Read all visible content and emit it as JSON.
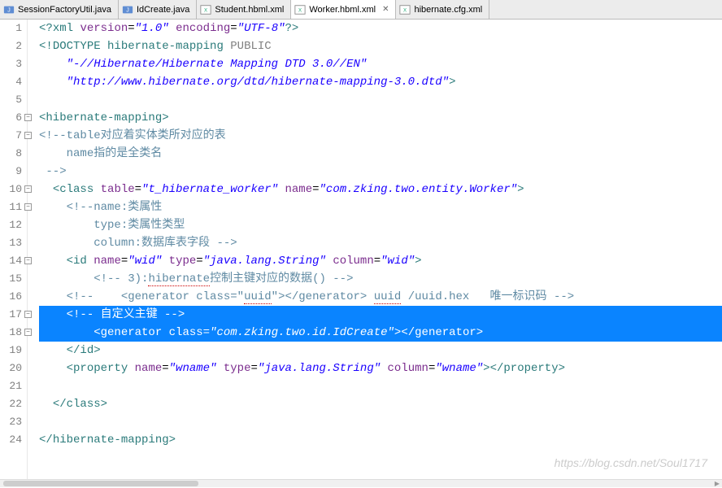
{
  "tabs": [
    {
      "label": "SessionFactoryUtil.java",
      "type": "java"
    },
    {
      "label": "IdCreate.java",
      "type": "java"
    },
    {
      "label": "Student.hbml.xml",
      "type": "xml"
    },
    {
      "label": "Worker.hbml.xml",
      "type": "xml",
      "active": true
    },
    {
      "label": "hibernate.cfg.xml",
      "type": "xml"
    }
  ],
  "gutter": [
    "1",
    "2",
    "3",
    "4",
    "5",
    "6",
    "7",
    "8",
    "9",
    "10",
    "11",
    "12",
    "13",
    "14",
    "15",
    "16",
    "17",
    "18",
    "19",
    "20",
    "21",
    "22",
    "23",
    "24"
  ],
  "code": {
    "l1": {
      "pi1": "<?",
      "tag": "xml",
      "sp": " ",
      "a1": "version",
      "eq": "=",
      "v1": "\"1.0\"",
      "sp2": " ",
      "a2": "encoding",
      "v2": "\"UTF-8\"",
      "pi2": "?>"
    },
    "l2": {
      "d1": "<!",
      "d2": "DOCTYPE",
      "sp": " ",
      "name": "hibernate-mapping",
      "sp2": " ",
      "pub": "PUBLIC"
    },
    "l3": {
      "pad": "    ",
      "v": "\"-//Hibernate/Hibernate Mapping DTD 3.0//EN\""
    },
    "l4": {
      "pad": "    ",
      "v": "\"http://www.hibernate.org/dtd/hibernate-mapping-3.0.dtd\"",
      "close": ">"
    },
    "l5": "",
    "l6": {
      "open": "<",
      "tag": "hibernate-mapping",
      "close": ">"
    },
    "l7": {
      "open": "<!--",
      "t1": "table",
      "cjk": "对应着实体类所对应的表"
    },
    "l8": {
      "pad": "    ",
      "t": "name",
      "cjk": "指的是全类名"
    },
    "l9": {
      "pad": " ",
      "close": "-->"
    },
    "l10": {
      "pad": "  ",
      "open": "<",
      "tag": "class",
      "sp": " ",
      "a1": "table",
      "eq": "=",
      "v1": "\"t_hibernate_worker\"",
      "sp2": " ",
      "a2": "name",
      "v2": "\"com.zking.two.entity.Worker\"",
      "close": ">"
    },
    "l11": {
      "pad": "    ",
      "open": "<!--",
      "t1": "name:",
      "cjk": "类属性"
    },
    "l12": {
      "pad": "        ",
      "t1": "type:",
      "cjk": "类属性类型"
    },
    "l13": {
      "pad": "        ",
      "t1": "column:",
      "cjk": "数据库表字段",
      "sp": " ",
      "close": "-->"
    },
    "l14": {
      "pad": "    ",
      "open": "<",
      "tag": "id",
      "sp": " ",
      "a1": "name",
      "eq": "=",
      "v1": "\"wid\"",
      "sp2": " ",
      "a2": "type",
      "v2": "\"java.lang.String\"",
      "sp3": " ",
      "a3": "column",
      "v3": "\"wid\"",
      "close": ">"
    },
    "l15": {
      "pad": "        ",
      "open": "<!--",
      "t1": " 3):",
      "sq": "hibernate",
      "cjk": "控制主键对应的数据",
      "paren": "()",
      "sp": " ",
      "close": "-->"
    },
    "l16": {
      "pad": "    ",
      "open": "<!--",
      "sp": "    ",
      "t1": "<generator class=\"",
      "uuid": "uuid",
      "t2": "\"></generator> ",
      "sq": "uuid",
      "t3": " /uuid.hex   ",
      "cjk": "唯一标识码",
      "sp2": " ",
      "close": "-->"
    },
    "l17": {
      "pad": "    ",
      "open": "<!--",
      "sp": " ",
      "cjk": "自定义主键",
      "sp2": " ",
      "close": "-->"
    },
    "l18": {
      "pad": "        ",
      "open": "<",
      "tag": "generator",
      "sp": " ",
      "a1": "class",
      "eq": "=",
      "v1": "\"com.zking.two.id.IdCreate\"",
      "close": ">",
      "open2": "</",
      "tag2": "generator",
      "close2": ">"
    },
    "l19": {
      "pad": "    ",
      "open": "</",
      "tag": "id",
      "close": ">"
    },
    "l20": {
      "pad": "    ",
      "open": "<",
      "tag": "property",
      "sp": " ",
      "a1": "name",
      "eq": "=",
      "v1": "\"wname\"",
      "sp2": " ",
      "a2": "type",
      "v2": "\"java.lang.String\"",
      "sp3": " ",
      "a3": "column",
      "v3": "\"wname\"",
      "close": ">",
      "open2": "</",
      "tag2": "property",
      "close2": ">"
    },
    "l21": "",
    "l22": {
      "pad": "  ",
      "open": "</",
      "tag": "class",
      "close": ">"
    },
    "l23": "",
    "l24": {
      "open": "</",
      "tag": "hibernate-mapping",
      "close": ">"
    }
  },
  "watermark": "https://blog.csdn.net/Soul1717",
  "fold_lines": [
    6,
    7,
    10,
    11,
    14,
    17,
    18
  ]
}
